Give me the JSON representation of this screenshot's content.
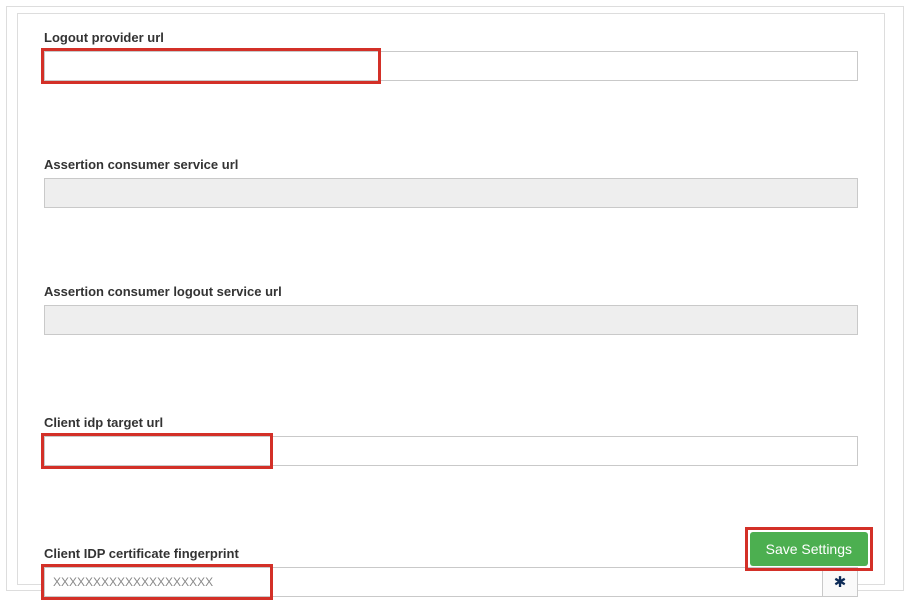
{
  "fields": {
    "logout_provider": {
      "label": "Logout provider url",
      "value": "",
      "placeholder": ""
    },
    "assertion_consumer": {
      "label": "Assertion consumer service url",
      "value": "",
      "placeholder": ""
    },
    "assertion_consumer_logout": {
      "label": "Assertion consumer logout service url",
      "value": "",
      "placeholder": ""
    },
    "client_idp_target": {
      "label": "Client idp target url",
      "value": "",
      "placeholder": ""
    },
    "client_idp_fingerprint": {
      "label": "Client IDP certificate fingerprint",
      "value": "XXXXXXXXXXXXXXXXXXXX",
      "placeholder": ""
    }
  },
  "buttons": {
    "save": "Save Settings"
  }
}
